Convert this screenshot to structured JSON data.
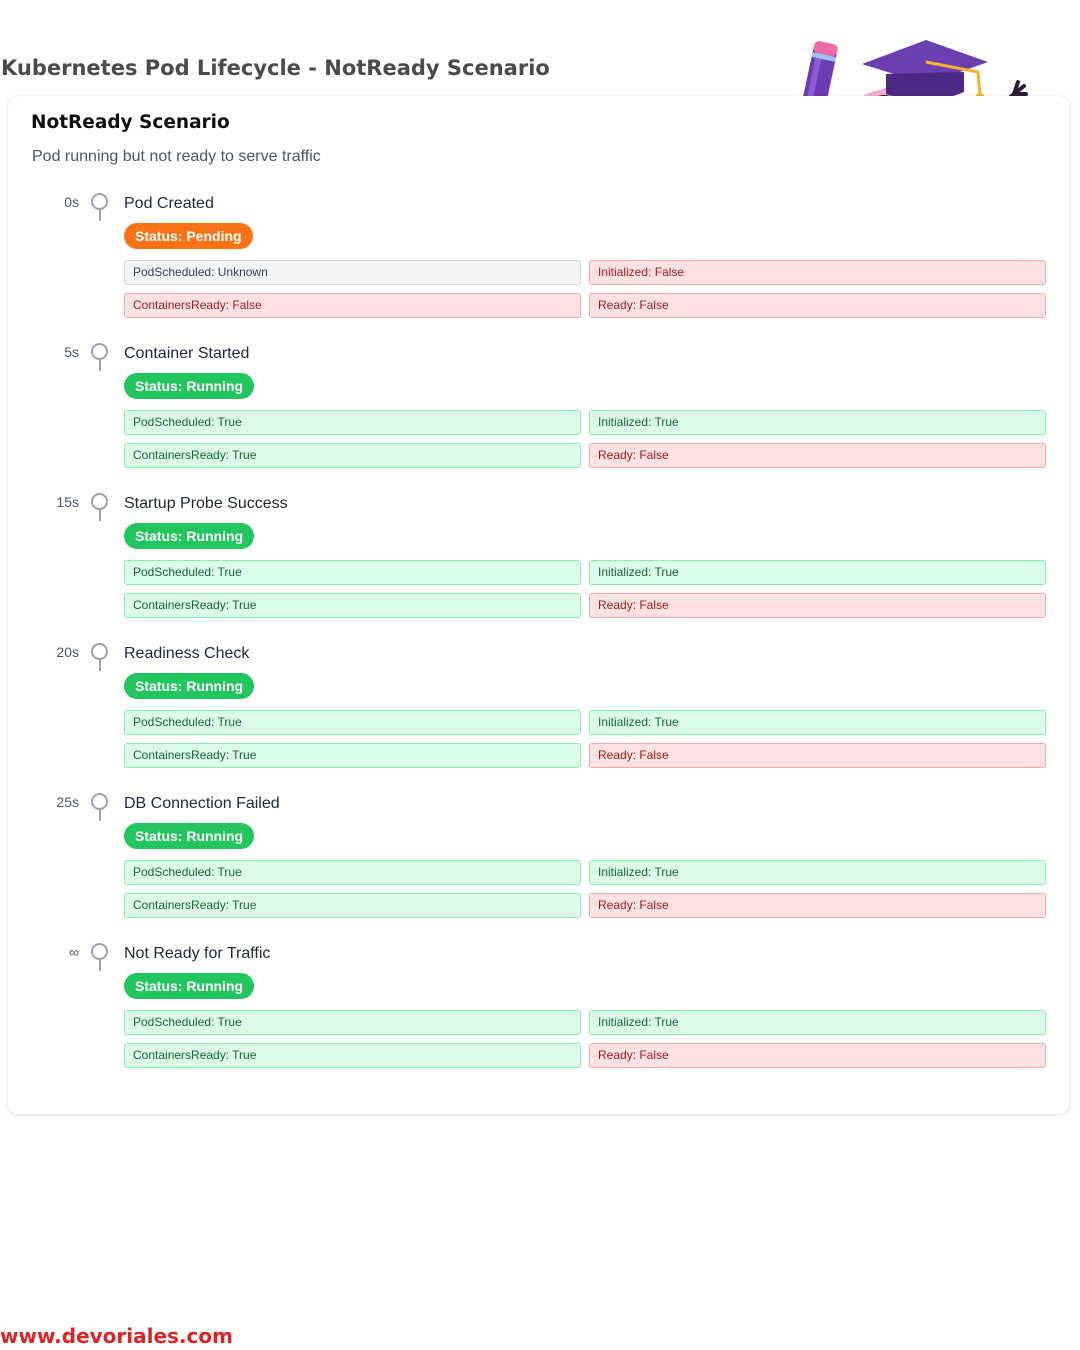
{
  "page_title": "Kubernetes Pod Lifecycle - NotReady Scenario",
  "card": {
    "title": "NotReady Scenario",
    "subtitle": "Pod running but not ready to serve traffic"
  },
  "steps": [
    {
      "time": "0s",
      "title": "Pod Created",
      "status": "Status: Pending",
      "status_kind": "pending",
      "conditions": [
        {
          "label": "PodScheduled: Unknown",
          "state": "unknown"
        },
        {
          "label": "Initialized: False",
          "state": "false"
        },
        {
          "label": "ContainersReady: False",
          "state": "false"
        },
        {
          "label": "Ready: False",
          "state": "false"
        }
      ]
    },
    {
      "time": "5s",
      "title": "Container Started",
      "status": "Status: Running",
      "status_kind": "running",
      "conditions": [
        {
          "label": "PodScheduled: True",
          "state": "true"
        },
        {
          "label": "Initialized: True",
          "state": "true"
        },
        {
          "label": "ContainersReady: True",
          "state": "true"
        },
        {
          "label": "Ready: False",
          "state": "false"
        }
      ]
    },
    {
      "time": "15s",
      "title": "Startup Probe Success",
      "status": "Status: Running",
      "status_kind": "running",
      "conditions": [
        {
          "label": "PodScheduled: True",
          "state": "true"
        },
        {
          "label": "Initialized: True",
          "state": "true"
        },
        {
          "label": "ContainersReady: True",
          "state": "true"
        },
        {
          "label": "Ready: False",
          "state": "false"
        }
      ]
    },
    {
      "time": "20s",
      "title": "Readiness Check",
      "status": "Status: Running",
      "status_kind": "running",
      "conditions": [
        {
          "label": "PodScheduled: True",
          "state": "true"
        },
        {
          "label": "Initialized: True",
          "state": "true"
        },
        {
          "label": "ContainersReady: True",
          "state": "true"
        },
        {
          "label": "Ready: False",
          "state": "false"
        }
      ]
    },
    {
      "time": "25s",
      "title": "DB Connection Failed",
      "status": "Status: Running",
      "status_kind": "running",
      "conditions": [
        {
          "label": "PodScheduled: True",
          "state": "true"
        },
        {
          "label": "Initialized: True",
          "state": "true"
        },
        {
          "label": "ContainersReady: True",
          "state": "true"
        },
        {
          "label": "Ready: False",
          "state": "false"
        }
      ]
    },
    {
      "time": "∞",
      "title": "Not Ready for Traffic",
      "status": "Status: Running",
      "status_kind": "running",
      "conditions": [
        {
          "label": "PodScheduled: True",
          "state": "true"
        },
        {
          "label": "Initialized: True",
          "state": "true"
        },
        {
          "label": "ContainersReady: True",
          "state": "true"
        },
        {
          "label": "Ready: False",
          "state": "false"
        }
      ]
    }
  ],
  "footer": {
    "url": "www.devoriales.com"
  },
  "mascot": {
    "icon": "brain-mascot-icon"
  },
  "colors": {
    "pending": "#f97316",
    "running": "#22c55e",
    "true_bg": "#dcfce7",
    "false_bg": "#fee2e2",
    "unknown_bg": "#f3f4f6",
    "footer": "#dc2626"
  }
}
